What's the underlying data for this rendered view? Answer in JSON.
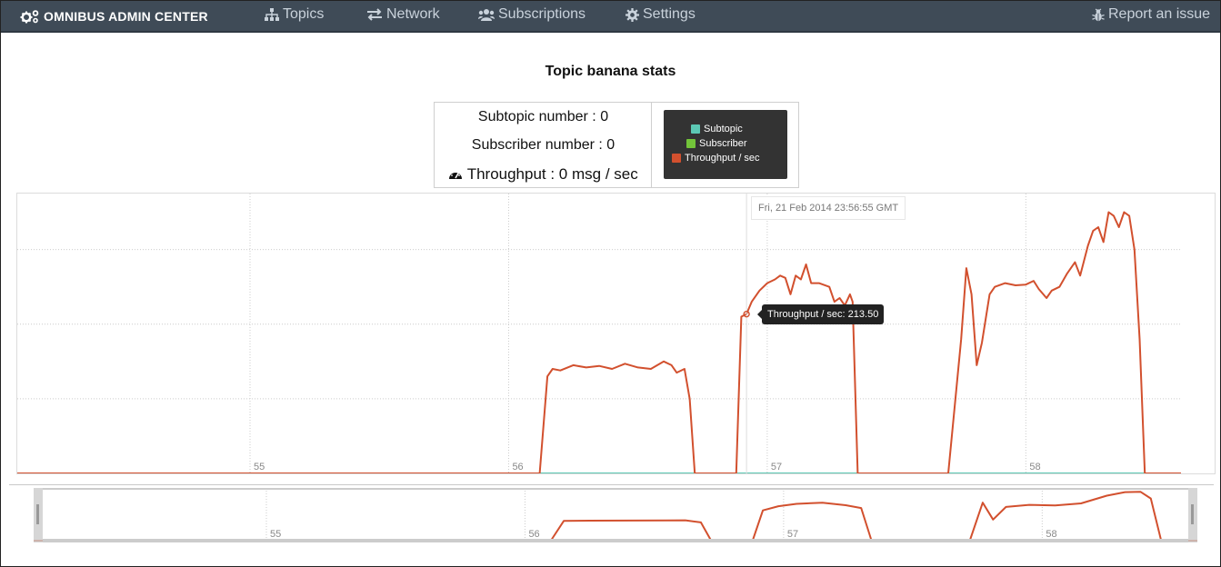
{
  "navbar": {
    "brand": "OMNIBUS ADMIN CENTER",
    "items": [
      {
        "label": "Topics",
        "icon": "sitemap-icon"
      },
      {
        "label": "Network",
        "icon": "exchange-icon"
      },
      {
        "label": "Subscriptions",
        "icon": "users-icon"
      },
      {
        "label": "Settings",
        "icon": "gear-icon"
      }
    ],
    "report": {
      "label": "Report an issue",
      "icon": "bug-icon"
    },
    "colors": {
      "background": "#3f4b57",
      "text": "#c9d2db"
    }
  },
  "page": {
    "title": "Topic banana stats"
  },
  "stats": {
    "subtopic": "Subtopic number : 0",
    "subscriber": "Subscriber number : 0",
    "throughput": "Throughput : 0 msg / sec",
    "throughput_icon": "dashboard-icon"
  },
  "legend": {
    "items": [
      {
        "label": "Subtopic",
        "color": "#5cc8b4"
      },
      {
        "label": "Subscriber",
        "color": "#73c43a"
      },
      {
        "label": "Throughput / sec",
        "color": "#d2502e"
      }
    ]
  },
  "tooltip": {
    "value_text": "Throughput / sec: 213.50",
    "date_text": "Fri, 21 Feb 2014 23:56:55 GMT"
  },
  "chart_data": [
    {
      "type": "line",
      "title": "",
      "xlabel": "",
      "ylabel": "",
      "x_ticks": [
        "55",
        "56",
        "57",
        "58"
      ],
      "y_ticks": [
        "100",
        "200",
        "300"
      ],
      "ylim": [
        0,
        375
      ],
      "xlim": [
        54.1,
        58.6
      ],
      "grid": true,
      "series": [
        {
          "name": "Throughput / sec",
          "color": "#d2502e",
          "points": [
            [
              54.1,
              0
            ],
            [
              55.95,
              0
            ],
            [
              56.12,
              0
            ],
            [
              56.15,
              130
            ],
            [
              56.17,
              140
            ],
            [
              56.2,
              138
            ],
            [
              56.25,
              145
            ],
            [
              56.3,
              142
            ],
            [
              56.35,
              144
            ],
            [
              56.4,
              140
            ],
            [
              56.45,
              147
            ],
            [
              56.5,
              142
            ],
            [
              56.55,
              140
            ],
            [
              56.6,
              150
            ],
            [
              56.63,
              145
            ],
            [
              56.65,
              135
            ],
            [
              56.68,
              140
            ],
            [
              56.7,
              100
            ],
            [
              56.72,
              0
            ],
            [
              56.85,
              0
            ],
            [
              56.88,
              0
            ],
            [
              56.9,
              210
            ],
            [
              56.92,
              213.5
            ],
            [
              56.94,
              230
            ],
            [
              56.97,
              245
            ],
            [
              57.0,
              255
            ],
            [
              57.03,
              260
            ],
            [
              57.05,
              265
            ],
            [
              57.07,
              262
            ],
            [
              57.09,
              240
            ],
            [
              57.11,
              265
            ],
            [
              57.13,
              260
            ],
            [
              57.15,
              280
            ],
            [
              57.17,
              255
            ],
            [
              57.2,
              255
            ],
            [
              57.24,
              250
            ],
            [
              57.26,
              230
            ],
            [
              57.28,
              235
            ],
            [
              57.3,
              225
            ],
            [
              57.32,
              240
            ],
            [
              57.33,
              230
            ],
            [
              57.35,
              0
            ],
            [
              57.7,
              0
            ],
            [
              57.75,
              180
            ],
            [
              57.77,
              275
            ],
            [
              57.79,
              240
            ],
            [
              57.81,
              145
            ],
            [
              57.83,
              175
            ],
            [
              57.86,
              240
            ],
            [
              57.88,
              250
            ],
            [
              57.92,
              255
            ],
            [
              57.96,
              252
            ],
            [
              58.0,
              253
            ],
            [
              58.03,
              258
            ],
            [
              58.05,
              247
            ],
            [
              58.08,
              235
            ],
            [
              58.1,
              245
            ],
            [
              58.13,
              250
            ],
            [
              58.16,
              268
            ],
            [
              58.19,
              283
            ],
            [
              58.21,
              265
            ],
            [
              58.24,
              305
            ],
            [
              58.26,
              325
            ],
            [
              58.28,
              330
            ],
            [
              58.3,
              310
            ],
            [
              58.32,
              350
            ],
            [
              58.34,
              345
            ],
            [
              58.36,
              330
            ],
            [
              58.38,
              350
            ],
            [
              58.4,
              345
            ],
            [
              58.42,
              300
            ],
            [
              58.44,
              180
            ],
            [
              58.46,
              0
            ],
            [
              58.6,
              0
            ]
          ]
        },
        {
          "name": "Subtopic",
          "color": "#5cc8b4",
          "points": [
            [
              54.1,
              0
            ],
            [
              58.6,
              0
            ]
          ]
        },
        {
          "name": "Subscriber",
          "color": "#73c43a",
          "points": [
            [
              54.1,
              0
            ],
            [
              58.6,
              0
            ]
          ]
        }
      ]
    },
    {
      "type": "line",
      "title": "",
      "xlabel": "",
      "ylabel": "",
      "x_ticks": [
        "55",
        "56",
        "57",
        "58"
      ],
      "ylim": [
        0,
        375
      ],
      "xlim": [
        54.1,
        58.6
      ],
      "grid": true,
      "series": [
        {
          "name": "Throughput / sec",
          "color": "#d2502e",
          "points": [
            [
              54.1,
              0
            ],
            [
              56.1,
              0
            ],
            [
              56.15,
              140
            ],
            [
              56.25,
              142
            ],
            [
              56.4,
              143
            ],
            [
              56.55,
              144
            ],
            [
              56.62,
              145
            ],
            [
              56.68,
              130
            ],
            [
              56.72,
              0
            ],
            [
              56.88,
              0
            ],
            [
              56.92,
              215
            ],
            [
              56.98,
              245
            ],
            [
              57.05,
              262
            ],
            [
              57.15,
              270
            ],
            [
              57.24,
              252
            ],
            [
              57.3,
              232
            ],
            [
              57.34,
              0
            ],
            [
              57.72,
              0
            ],
            [
              57.77,
              270
            ],
            [
              57.81,
              150
            ],
            [
              57.86,
              240
            ],
            [
              57.95,
              255
            ],
            [
              58.05,
              250
            ],
            [
              58.15,
              265
            ],
            [
              58.25,
              320
            ],
            [
              58.32,
              345
            ],
            [
              58.38,
              348
            ],
            [
              58.42,
              300
            ],
            [
              58.46,
              0
            ],
            [
              58.6,
              0
            ]
          ]
        },
        {
          "name": "Subtopic",
          "color": "#5cc8b4",
          "points": [
            [
              54.1,
              0
            ],
            [
              58.6,
              0
            ]
          ]
        }
      ]
    }
  ]
}
